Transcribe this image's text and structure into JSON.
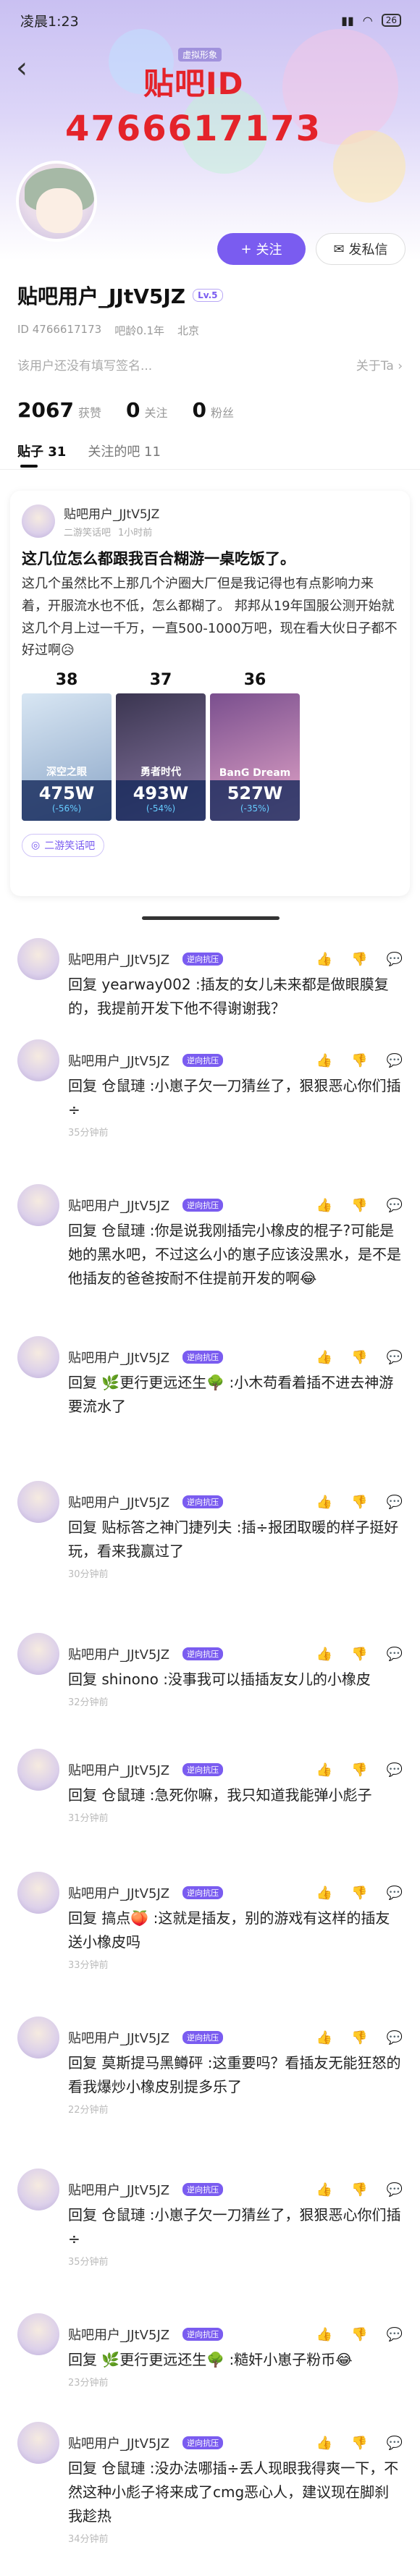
{
  "status": {
    "time": "凌晨1:23",
    "battery": "26"
  },
  "watermark": {
    "tag": "虚拟形象",
    "line1": "贴吧ID",
    "line2": "4766617173"
  },
  "actions": {
    "follow": "关注",
    "follow_icon": "+",
    "dm": "发私信"
  },
  "profile": {
    "name": "贴吧用户_JJtV5JZ",
    "level": "Lv.5",
    "id_text": "ID 4766617173",
    "age": "吧龄0.1年",
    "location": "北京",
    "bio": "该用户还没有填写签名...",
    "about": "关于Ta",
    "stats": [
      {
        "num": "2067",
        "label": "获赞"
      },
      {
        "num": "0",
        "label": "关注"
      },
      {
        "num": "0",
        "label": "粉丝"
      }
    ]
  },
  "tabs": [
    {
      "label": "贴子 31"
    },
    {
      "label": "关注的吧 11"
    }
  ],
  "post": {
    "user": "贴吧用户_JJtV5JZ",
    "forum": "二游笑话吧",
    "time": "1小时前",
    "title": "这几位怎么都跟我百合糊游一桌吃饭了。",
    "body": "这几个虽然比不上那几个沪圈大厂但是我记得也有点影响力来着，开服流水也不低，怎么都糊了。 邦邦从19年国服公测开始就这几个月上过一千万，一直500-1000万吧，现在看大伙日子都不好过啊😥",
    "games": [
      {
        "rank": "38",
        "name": "深空之眼",
        "value": "475W",
        "pct": "(-56%)"
      },
      {
        "rank": "37",
        "name": "勇者时代",
        "value": "493W",
        "pct": "(-54%)"
      },
      {
        "rank": "36",
        "name": "BanG Dream",
        "value": "527W",
        "pct": "(-35%)"
      }
    ],
    "chip": "二游笑话吧"
  },
  "replies": [
    {
      "name": "贴吧用户_JJtV5JZ",
      "badge": "逆向抗压",
      "text": "回复 yearway002 :插友的女儿未来都是做眼膜复的，我提前开发下他不得谢谢我？",
      "time": ""
    },
    {
      "name": "贴吧用户_JJtV5JZ",
      "badge": "逆向抗压",
      "text": "回复 仓鼠璉 :小崽子欠一刀猜丝了，狠狠恶心你们插÷",
      "time": "35分钟前"
    },
    {
      "name": "贴吧用户_JJtV5JZ",
      "badge": "逆向抗压",
      "text": "回复 仓鼠璉 :你是说我刚插完小橡皮的棍子?可能是她的黑水吧，不过这么小的崽子应该没黑水，是不是他插友的爸爸按耐不住提前开发的啊😂",
      "time": ""
    },
    {
      "name": "贴吧用户_JJtV5JZ",
      "badge": "逆向抗压",
      "text": "回复 🌿更行更远还生🌳 :小木苟看着插不进去神游要流水了",
      "time": ""
    },
    {
      "name": "贴吧用户_JJtV5JZ",
      "badge": "逆向抗压",
      "text": "回复 贴标答之神门捷列夫 :插÷报团取暖的样子挺好玩，看来我赢过了",
      "time": "30分钟前"
    },
    {
      "name": "贴吧用户_JJtV5JZ",
      "badge": "逆向抗压",
      "text": "回复 shinono :没事我可以插插友女儿的小橡皮",
      "time": "32分钟前"
    },
    {
      "name": "贴吧用户_JJtV5JZ",
      "badge": "逆向抗压",
      "text": "回复 仓鼠璉 :急死你嘛，我只知道我能弹小彪子",
      "time": "31分钟前"
    },
    {
      "name": "贴吧用户_JJtV5JZ",
      "badge": "逆向抗压",
      "text": "回复 搞点🍑 :这就是插友，别的游戏有这样的插友送小橡皮吗",
      "time": "33分钟前"
    },
    {
      "name": "贴吧用户_JJtV5JZ",
      "badge": "逆向抗压",
      "text": "回复 莫斯提马黑鳟砰 :这重要吗？看插友无能狂怒的看我爆炒小橡皮别提多乐了",
      "time": "22分钟前"
    },
    {
      "name": "贴吧用户_JJtV5JZ",
      "badge": "逆向抗压",
      "text": "回复 仓鼠璉 :小崽子欠一刀猜丝了，狠狠恶心你们插÷",
      "time": "35分钟前"
    },
    {
      "name": "贴吧用户_JJtV5JZ",
      "badge": "逆向抗压",
      "text": "回复 🌿更行更远还生🌳 :糙奸小崽子粉币😂",
      "time": "23分钟前"
    },
    {
      "name": "贴吧用户_JJtV5JZ",
      "badge": "逆向抗压",
      "text": "回复 仓鼠璉 :没办法哪插÷丢人现眼我得爽一下，不然这种小彪子将来成了cmg恶心人，建议现在脚刹我趁热",
      "time": "34分钟前"
    }
  ],
  "icons": {
    "like": "👍",
    "dislike": "👎",
    "reply": "💬"
  }
}
